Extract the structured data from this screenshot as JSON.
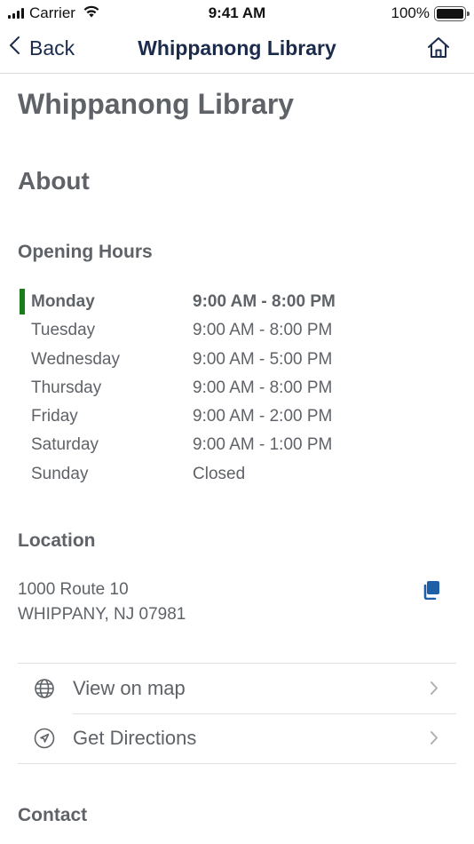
{
  "status_bar": {
    "carrier": "Carrier",
    "time": "9:41 AM",
    "battery": "100%"
  },
  "nav": {
    "back_label": "Back",
    "title": "Whippanong Library"
  },
  "page": {
    "title": "Whippanong Library",
    "about_heading": "About",
    "hours_heading": "Opening Hours",
    "hours": [
      {
        "day": "Monday",
        "time": "9:00 AM - 8:00 PM"
      },
      {
        "day": "Tuesday",
        "time": "9:00 AM - 8:00 PM"
      },
      {
        "day": "Wednesday",
        "time": "9:00 AM - 5:00 PM"
      },
      {
        "day": "Thursday",
        "time": "9:00 AM - 8:00 PM"
      },
      {
        "day": "Friday",
        "time": "9:00 AM - 2:00 PM"
      },
      {
        "day": "Saturday",
        "time": "9:00 AM - 1:00 PM"
      },
      {
        "day": "Sunday",
        "time": "Closed"
      }
    ],
    "location_heading": "Location",
    "address_line1": "1000 Route 10",
    "address_line2": "WHIPPANY, NJ 07981",
    "actions": [
      {
        "label": "View on map",
        "icon": "globe-icon"
      },
      {
        "label": "Get Directions",
        "icon": "navigation-icon"
      }
    ],
    "contact_heading": "Contact"
  },
  "colors": {
    "nav_text": "#1a2b4c",
    "body_text": "#5f6368",
    "today_marker": "#1a7d1a",
    "copy_icon": "#1f5fa8"
  }
}
